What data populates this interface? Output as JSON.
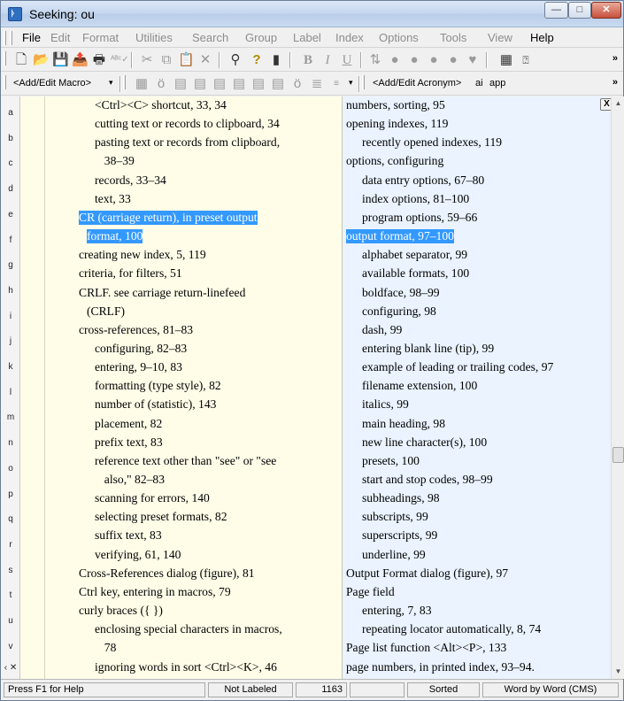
{
  "window": {
    "title": "Seeking: ou",
    "minimize_glyph": "—",
    "maximize_glyph": "□",
    "close_glyph": "✕"
  },
  "menubar": {
    "items": [
      {
        "label": "File",
        "enabled": true
      },
      {
        "label": "Edit",
        "enabled": false
      },
      {
        "label": "Format",
        "enabled": false
      },
      {
        "label": "Utilities",
        "enabled": false
      },
      {
        "label": "Search",
        "enabled": false
      },
      {
        "label": "Group",
        "enabled": false
      },
      {
        "label": "Label",
        "enabled": false
      },
      {
        "label": "Index",
        "enabled": false
      },
      {
        "label": "Options",
        "enabled": false
      },
      {
        "label": "Tools",
        "enabled": false
      },
      {
        "label": "View",
        "enabled": false
      },
      {
        "label": "Help",
        "enabled": true
      }
    ],
    "overflow": "»"
  },
  "toolbar1": {
    "icons": [
      "new-document-icon",
      "open-folder-icon",
      "save-icon",
      "export-icon",
      "print-icon",
      "spellcheck-icon",
      "cut-icon",
      "copy-icon",
      "paste-icon",
      "delete-icon",
      "find-icon",
      "query-icon",
      "ruler-icon",
      "bold-icon",
      "italic-icon",
      "underline-icon",
      "sort-icon",
      "record-color-1-icon",
      "record-color-2-icon",
      "record-color-3-icon",
      "tag-icon",
      "calculator-icon",
      "help-icon"
    ],
    "bold": "B",
    "italic": "I",
    "underline": "U",
    "overflow": "»"
  },
  "toolbar2": {
    "macro_label": "<Add/Edit Macro>",
    "acronym_label": "<Add/Edit Acronym>",
    "acronym_ai": "ai",
    "acronym_app": "app",
    "overflow": "»"
  },
  "letters": [
    "a",
    "b",
    "c",
    "d",
    "e",
    "f",
    "g",
    "h",
    "i",
    "j",
    "k",
    "l",
    "m",
    "n",
    "o",
    "p",
    "q",
    "r",
    "s",
    "t",
    "u",
    "v"
  ],
  "letter_scroll_glyph": "‹ ✕",
  "left_entries": [
    {
      "text": "<Ctrl><C> shortcut, 33, 34",
      "indent": 1,
      "hl": false
    },
    {
      "text": "cutting text or records to clipboard, 34",
      "indent": 1,
      "hl": false
    },
    {
      "text": "pasting text or records from clipboard,",
      "indent": 1,
      "hl": false
    },
    {
      "text": "38–39",
      "indent": 2,
      "hl": false
    },
    {
      "text": "records, 33–34",
      "indent": 1,
      "hl": false
    },
    {
      "text": "text, 33",
      "indent": 1,
      "hl": false
    },
    {
      "text": "CR (carriage return), in preset output",
      "indent": 0,
      "hl": true
    },
    {
      "text": "format, 100",
      "indent": 3,
      "hl": true
    },
    {
      "text": "creating new index, 5, 119",
      "indent": 0,
      "hl": false
    },
    {
      "text": "criteria, for filters, 51",
      "indent": 0,
      "hl": false
    },
    {
      "text": "CRLF. see carriage return-linefeed",
      "indent": 0,
      "hl": false
    },
    {
      "text": "(CRLF)",
      "indent": 3,
      "hl": false
    },
    {
      "text": "cross-references, 81–83",
      "indent": 0,
      "hl": false
    },
    {
      "text": "configuring, 82–83",
      "indent": 1,
      "hl": false
    },
    {
      "text": "entering, 9–10, 83",
      "indent": 1,
      "hl": false
    },
    {
      "text": "formatting (type style), 82",
      "indent": 1,
      "hl": false
    },
    {
      "text": "number of (statistic), 143",
      "indent": 1,
      "hl": false
    },
    {
      "text": "placement, 82",
      "indent": 1,
      "hl": false
    },
    {
      "text": "prefix text, 83",
      "indent": 1,
      "hl": false
    },
    {
      "text": "reference text other than \"see\" or \"see",
      "indent": 1,
      "hl": false
    },
    {
      "text": "also,\" 82–83",
      "indent": 2,
      "hl": false
    },
    {
      "text": "scanning for errors, 140",
      "indent": 1,
      "hl": false
    },
    {
      "text": "selecting preset formats, 82",
      "indent": 1,
      "hl": false
    },
    {
      "text": "suffix text, 83",
      "indent": 1,
      "hl": false
    },
    {
      "text": "verifying, 61, 140",
      "indent": 1,
      "hl": false
    },
    {
      "text": "Cross-References dialog (figure), 81",
      "indent": 0,
      "hl": false
    },
    {
      "text": "Ctrl key, entering in macros, 79",
      "indent": 0,
      "hl": false
    },
    {
      "text": "curly braces ({ })",
      "indent": 0,
      "hl": false
    },
    {
      "text": "enclosing special characters in macros,",
      "indent": 1,
      "hl": false
    },
    {
      "text": "78",
      "indent": 2,
      "hl": false
    },
    {
      "text": "ignoring words in sort <Ctrl><K>, 46",
      "indent": 1,
      "hl": false
    }
  ],
  "right_entries": [
    {
      "text": "numbers, sorting, 95",
      "indent": 0,
      "hl": false
    },
    {
      "text": "opening indexes, 119",
      "indent": 0,
      "hl": false
    },
    {
      "text": "recently opened indexes, 119",
      "indent": 1,
      "hl": false
    },
    {
      "text": "options, configuring",
      "indent": 0,
      "hl": false
    },
    {
      "text": "data entry options, 67–80",
      "indent": 1,
      "hl": false
    },
    {
      "text": "index options, 81–100",
      "indent": 1,
      "hl": false
    },
    {
      "text": "program options, 59–66",
      "indent": 1,
      "hl": false
    },
    {
      "text": "output format, 97–100",
      "indent": 0,
      "hl": true
    },
    {
      "text": "alphabet separator, 99",
      "indent": 1,
      "hl": false
    },
    {
      "text": "available formats, 100",
      "indent": 1,
      "hl": false
    },
    {
      "text": "boldface, 98–99",
      "indent": 1,
      "hl": false
    },
    {
      "text": "configuring, 98",
      "indent": 1,
      "hl": false
    },
    {
      "text": "dash, 99",
      "indent": 1,
      "hl": false
    },
    {
      "text": "entering blank line (tip), 99",
      "indent": 1,
      "hl": false
    },
    {
      "text": "example of leading or trailing codes, 97",
      "indent": 1,
      "hl": false
    },
    {
      "text": "filename extension, 100",
      "indent": 1,
      "hl": false
    },
    {
      "text": "italics, 99",
      "indent": 1,
      "hl": false
    },
    {
      "text": "main heading, 98",
      "indent": 1,
      "hl": false
    },
    {
      "text": "new line character(s), 100",
      "indent": 1,
      "hl": false
    },
    {
      "text": "presets, 100",
      "indent": 1,
      "hl": false
    },
    {
      "text": "start and stop codes, 98–99",
      "indent": 1,
      "hl": false
    },
    {
      "text": "subheadings, 98",
      "indent": 1,
      "hl": false
    },
    {
      "text": "subscripts, 99",
      "indent": 1,
      "hl": false
    },
    {
      "text": "superscripts, 99",
      "indent": 1,
      "hl": false
    },
    {
      "text": "underline, 99",
      "indent": 1,
      "hl": false
    },
    {
      "text": "Output Format dialog (figure), 97",
      "indent": 0,
      "hl": false
    },
    {
      "text": "Page field",
      "indent": 0,
      "hl": false
    },
    {
      "text": "entering, 7, 83",
      "indent": 1,
      "hl": false
    },
    {
      "text": "repeating locator automatically, 8, 74",
      "indent": 1,
      "hl": false
    },
    {
      "text": "Page list function <Alt><P>, 133",
      "indent": 0,
      "hl": false
    },
    {
      "text": "page numbers, in printed index, 93–94.",
      "indent": 0,
      "hl": false
    }
  ],
  "close_pane_label": "X",
  "statusbar": {
    "help": "Press F1 for Help",
    "label": "Not Labeled",
    "count": "1163",
    "blank": "",
    "sorted": "Sorted",
    "sort_mode": "Word by Word (CMS)"
  },
  "colors": {
    "highlight": "#3399ff",
    "left_pane_bg": "#fffde8",
    "right_pane_bg": "#eaf3ff"
  }
}
